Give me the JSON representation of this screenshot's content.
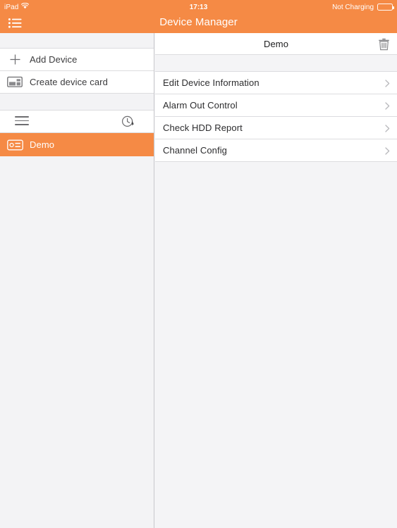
{
  "status_bar": {
    "device_label": "iPad",
    "wifi_icon": "wifi-icon",
    "time": "17:13",
    "battery_text": "Not Charging",
    "battery_icon": "battery-icon"
  },
  "nav_bar": {
    "title": "Device Manager",
    "list_icon": "list-bullet-icon"
  },
  "sidebar": {
    "items": [
      {
        "label": "Add Device",
        "icon": "plus-icon"
      },
      {
        "label": "Create device card",
        "icon": "device-card-icon"
      }
    ],
    "toolbar": {
      "menu_icon": "hamburger-icon",
      "history_icon": "clock-history-icon"
    },
    "devices": [
      {
        "label": "Demo",
        "icon": "dvr-device-icon",
        "selected": true
      }
    ]
  },
  "detail": {
    "title": "Demo",
    "delete_icon": "trash-icon",
    "menu": [
      {
        "label": "Edit Device Information",
        "accessory": "chevron-right-icon"
      },
      {
        "label": "Alarm Out Control",
        "accessory": "chevron-right-icon"
      },
      {
        "label": "Check HDD Report",
        "accessory": "chevron-right-icon"
      },
      {
        "label": "Channel Config",
        "accessory": "chevron-right-icon"
      }
    ]
  },
  "colors": {
    "accent": "#F58A45",
    "panel_bg": "#f4f4f6",
    "row_bg": "#ffffff",
    "divider": "#dcdcdf",
    "text_primary": "#2c2c2e",
    "icon_gray": "#6d6d70"
  }
}
